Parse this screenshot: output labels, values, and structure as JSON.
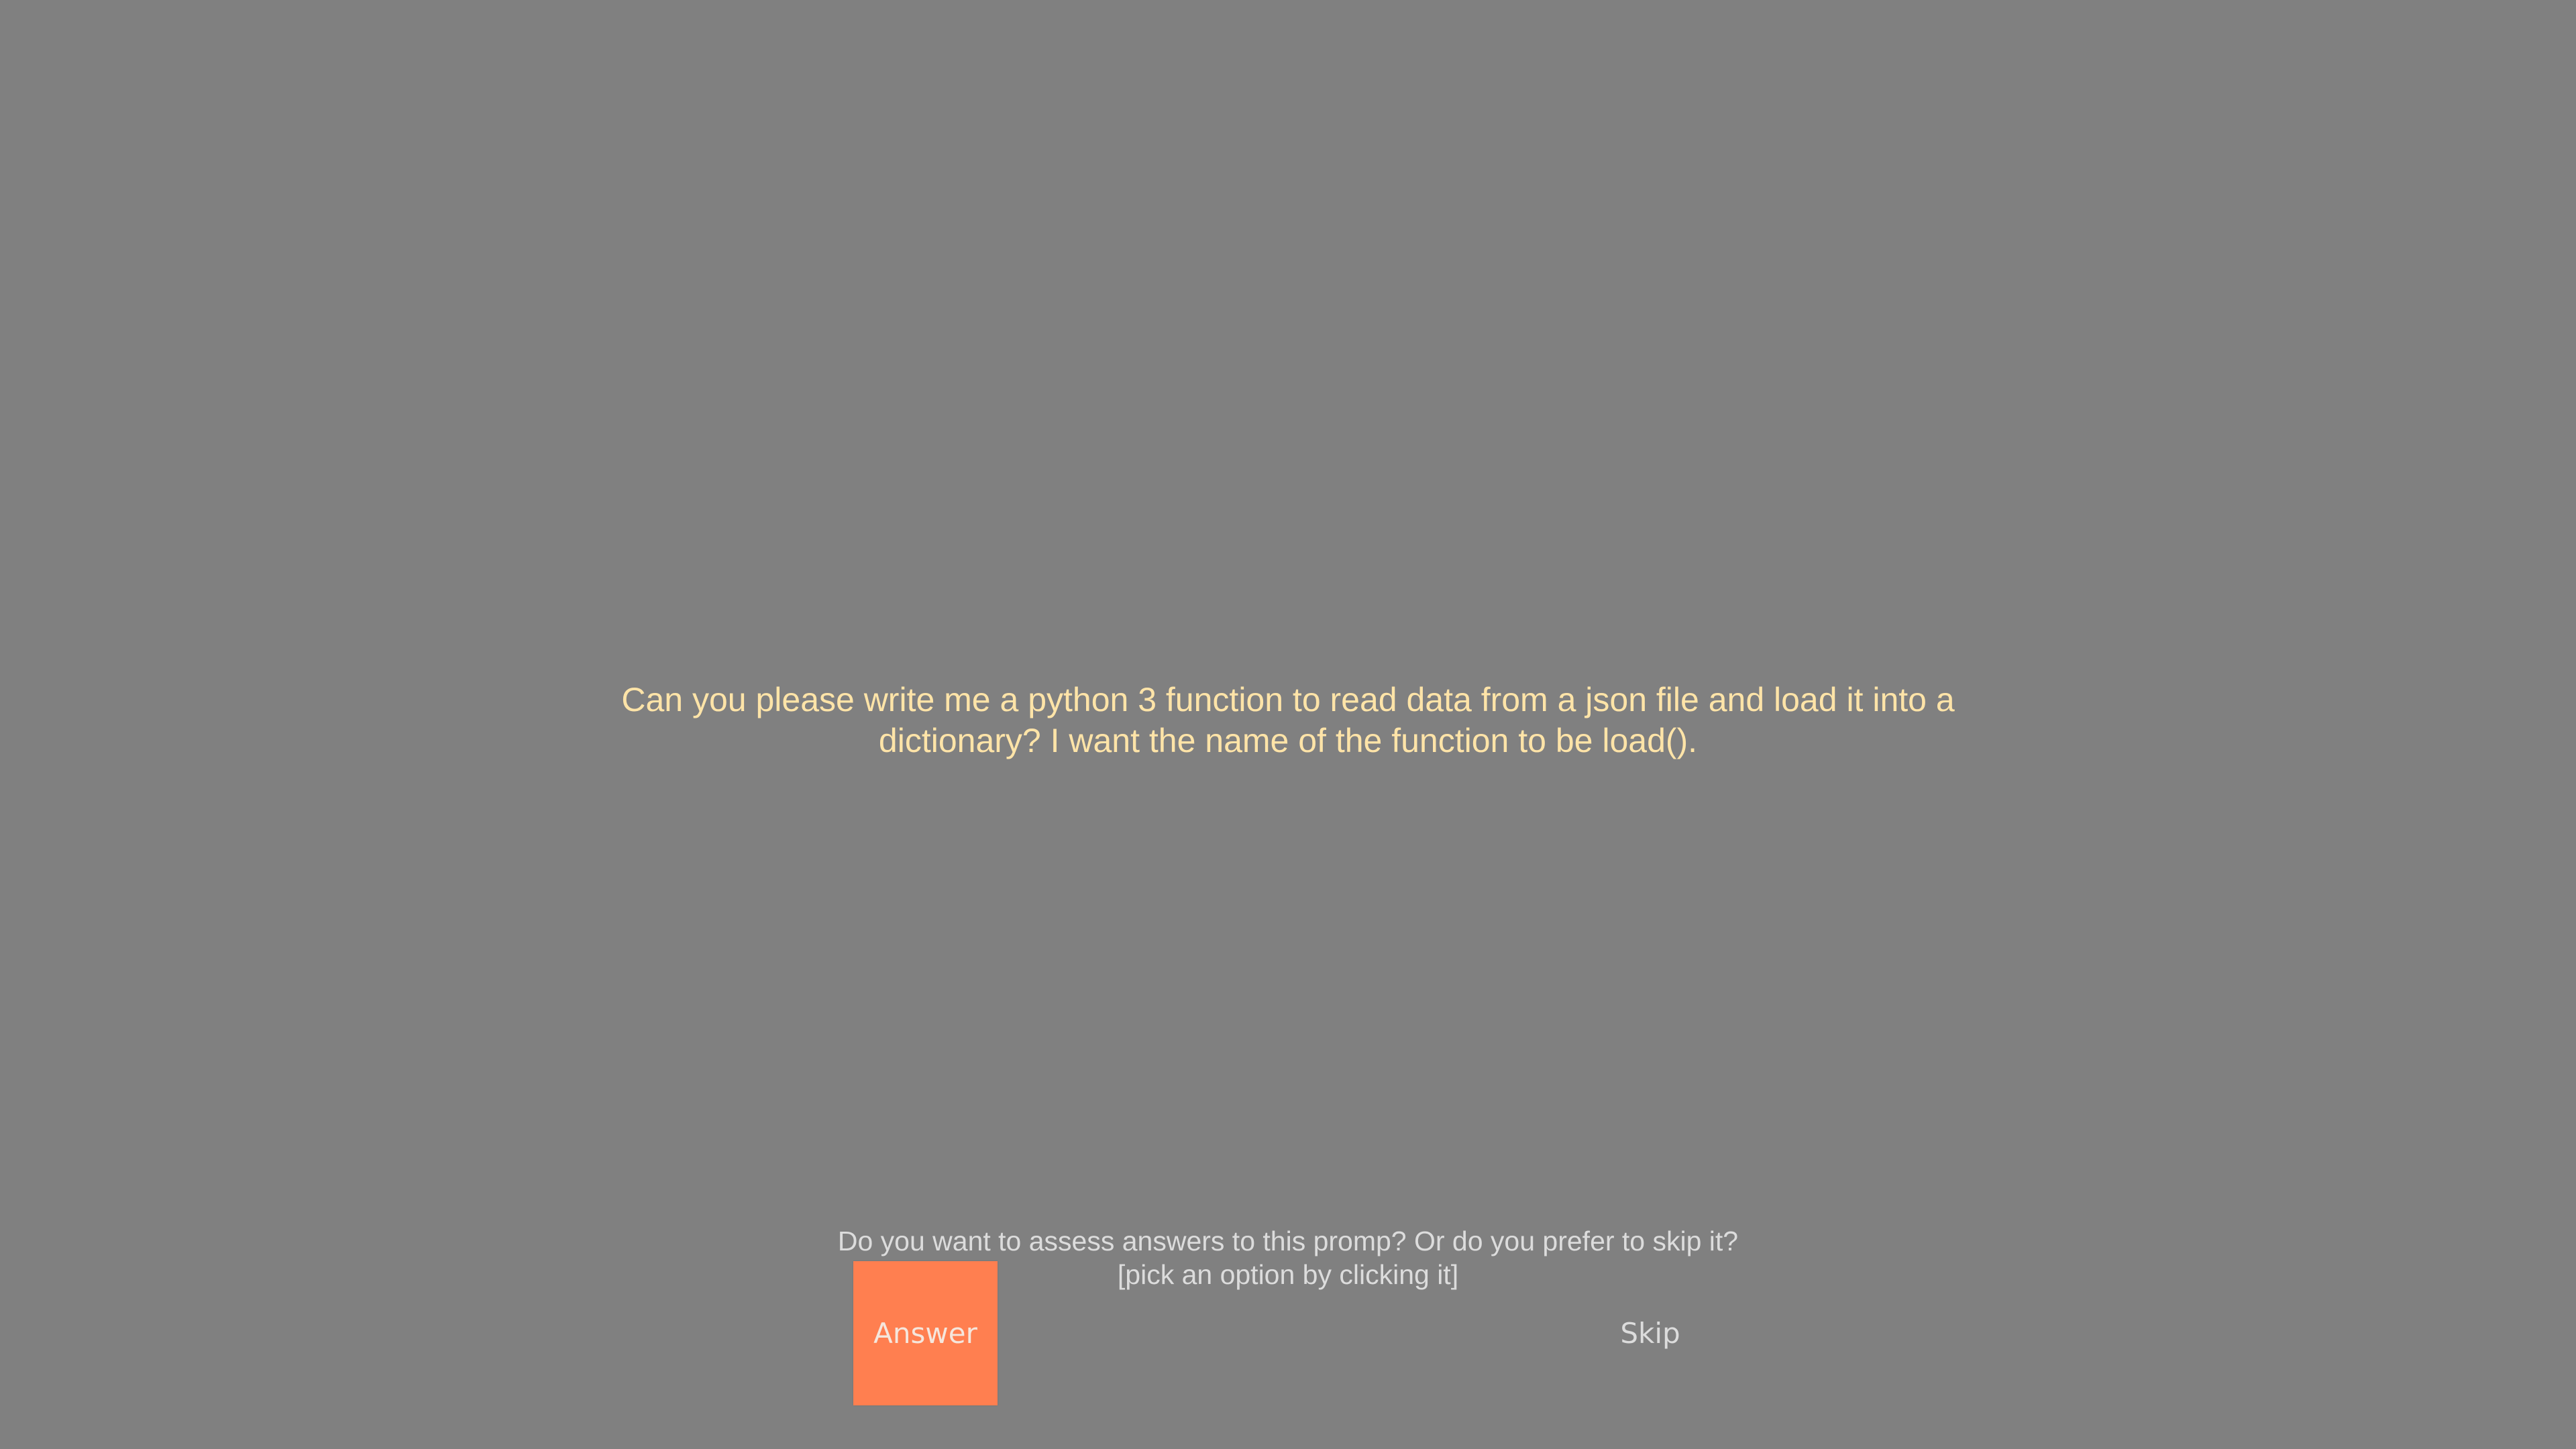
{
  "prompt": {
    "line1": "Can you please write me a python 3 function to read data from a json file and load it into a",
    "line2": "dictionary? I want the name of the function to be load()."
  },
  "question": {
    "line1": "Do you want to assess answers to this promp?  Or do you prefer to skip it?",
    "line2": "[pick an option by clicking it]"
  },
  "buttons": {
    "answer_label": "Answer",
    "skip_label": "Skip"
  },
  "colors": {
    "background": "#808080",
    "prompt_text": "#ffe4a8",
    "secondary_text": "#dcdcdc",
    "answer_button": "#ff7f50"
  }
}
